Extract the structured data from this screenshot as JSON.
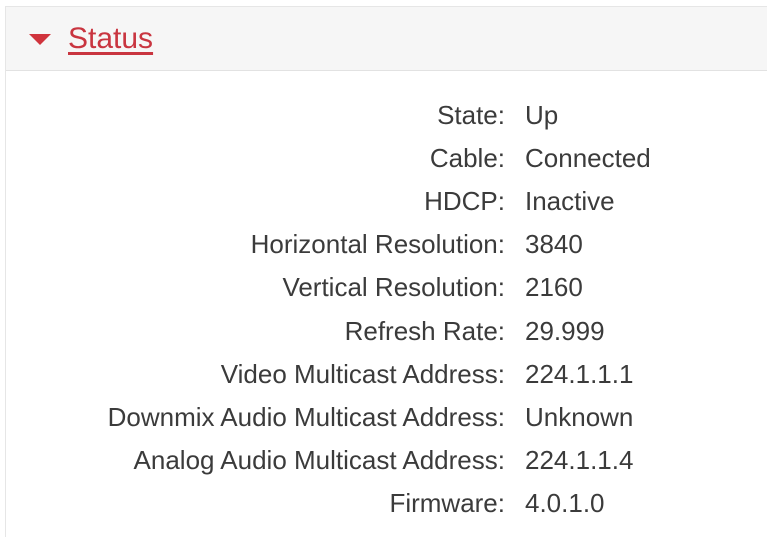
{
  "panel": {
    "title": "Status",
    "caret_icon": "caret-down-icon",
    "accent_color": "#c93540"
  },
  "status": {
    "rows": [
      {
        "label": "State:",
        "value": "Up"
      },
      {
        "label": "Cable:",
        "value": "Connected"
      },
      {
        "label": "HDCP:",
        "value": "Inactive"
      },
      {
        "label": "Horizontal Resolution:",
        "value": "3840"
      },
      {
        "label": "Vertical Resolution:",
        "value": "2160"
      },
      {
        "label": "Refresh Rate:",
        "value": "29.999"
      },
      {
        "label": "Video Multicast Address:",
        "value": "224.1.1.1"
      },
      {
        "label": "Downmix Audio Multicast Address:",
        "value": "Unknown"
      },
      {
        "label": "Analog Audio Multicast Address:",
        "value": "224.1.1.4"
      },
      {
        "label": "Firmware:",
        "value": "4.0.1.0"
      }
    ]
  }
}
